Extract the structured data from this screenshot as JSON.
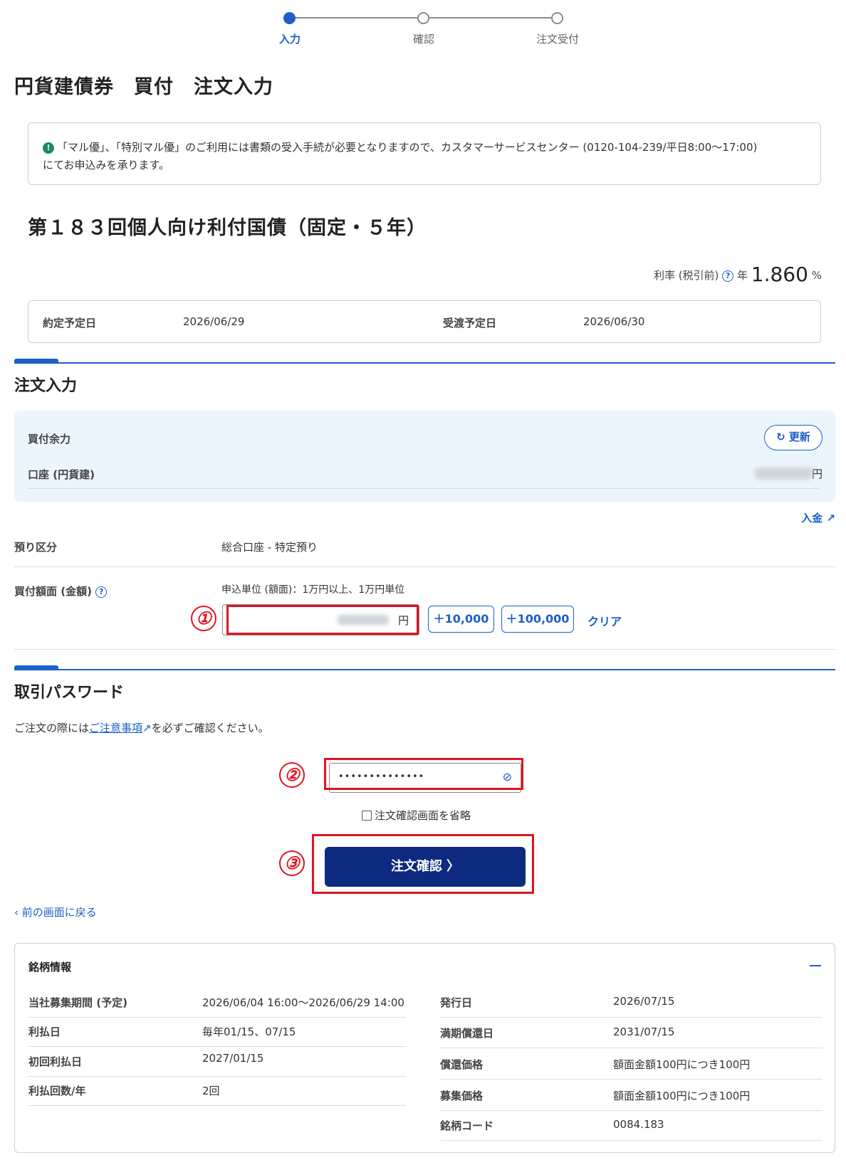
{
  "stepper": {
    "steps": [
      "入力",
      "確認",
      "注文受付"
    ],
    "active_index": 0
  },
  "page_title": "円貨建債券　買付　注文入力",
  "notice": {
    "icon": "exclamation-icon",
    "text_line1": "「マル優」、「特別マル優」のご利用には書類の受入手続が必要となりますので、カスタマーサービスセンター (0120-104-239/平日8:00〜17:00)",
    "text_line2": "にてお申込みを承ります。"
  },
  "bond_title": "第１８３回個人向け利付国債（固定・５年）",
  "rate": {
    "label": "利率 (税引前)",
    "prefix": "年",
    "value": "1.860",
    "unit": "%"
  },
  "dates": {
    "contract_label": "約定予定日",
    "contract_value": "2026/06/29",
    "delivery_label": "受渡予定日",
    "delivery_value": "2026/06/30"
  },
  "order_section": {
    "title": "注文入力",
    "balance_label": "買付余力",
    "refresh_label": "更新",
    "account_label": "口座 (円貨建)",
    "account_unit": "円",
    "deposit_link": "入金",
    "custody_label": "預り区分",
    "custody_value": "総合口座 - 特定預り",
    "amount_label": "買付額面 (金額)",
    "amount_hint": "申込単位 (額面)：1万円以上、1万円単位",
    "amount_unit": "円",
    "add_10000": "10,000",
    "add_100000": "100,000",
    "clear_label": "クリア"
  },
  "password_section": {
    "title": "取引パスワード",
    "note_prefix": "ご注文の際には",
    "note_link": "ご注意事項",
    "note_suffix": "を必ずご確認ください。",
    "password_value": "••••••••••••••",
    "skip_label": "注文確認画面を省略",
    "confirm_label": "注文確認"
  },
  "back_label": "前の画面に戻る",
  "annotations": [
    "①",
    "②",
    "③"
  ],
  "info": {
    "title": "銘柄情報",
    "left": [
      {
        "label": "当社募集期間 (予定)",
        "value": "2026/06/04 16:00〜2026/06/29 14:00"
      },
      {
        "label": "利払日",
        "value": "毎年01/15、07/15"
      },
      {
        "label": "初回利払日",
        "value": "2027/01/15"
      },
      {
        "label": "利払回数/年",
        "value": "2回"
      }
    ],
    "right": [
      {
        "label": "発行日",
        "value": "2026/07/15"
      },
      {
        "label": "満期償還日",
        "value": "2031/07/15"
      },
      {
        "label": "償還価格",
        "value": "額面金額100円につき100円"
      },
      {
        "label": "募集価格",
        "value": "額面金額100円につき100円"
      },
      {
        "label": "銘柄コード",
        "value": "0084.183"
      }
    ]
  },
  "colors": {
    "accent": "#1e5fc8",
    "primary_button": "#0d2a80",
    "annotation_red": "#e0141e",
    "balance_bg": "#eaf5fc"
  }
}
